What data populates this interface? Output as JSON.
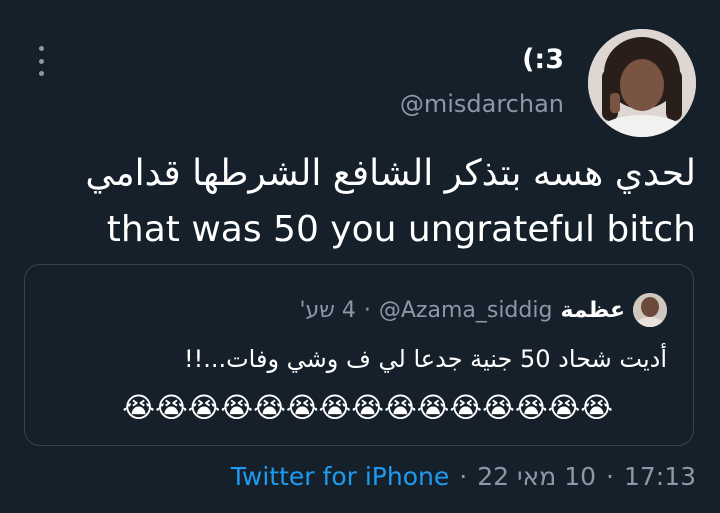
{
  "author": {
    "display_name": "(:3",
    "handle": "@misdarchan"
  },
  "tweet": {
    "text_line1": "لحدي هسه بتذكر الشافع الشرطها قدامي",
    "text_line2": "that was 50 you ungrateful bitch"
  },
  "quoted": {
    "name": "عظمة",
    "handle": "@Azama_siddig",
    "separator": "·",
    "time": "4 שע'",
    "text": "أديت شحاد 50 جنية جدعا لي ف وشي وفات...!!",
    "emojis": "😭😭😭😭😭😭😭😭😭😭😭😭😭😭😭"
  },
  "footer": {
    "time": "17:13",
    "dot1": "·",
    "date": "10 מאי 22",
    "dot2": "·",
    "source": "Twitter for iPhone"
  },
  "colors": {
    "background": "#15202b",
    "secondary_text": "#8b98a5",
    "link": "#1d9bf0",
    "border": "#38444d"
  },
  "icons": {
    "more": "more-vertical-icon"
  }
}
